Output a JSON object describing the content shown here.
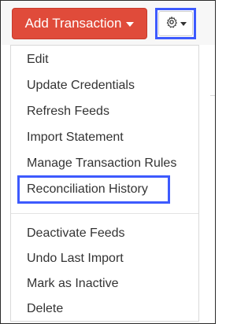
{
  "toolbar": {
    "add_transaction_label": "Add Transaction"
  },
  "menu": {
    "items": [
      {
        "label": "Edit"
      },
      {
        "label": "Update Credentials"
      },
      {
        "label": "Refresh Feeds"
      },
      {
        "label": "Import Statement"
      },
      {
        "label": "Manage Transaction Rules"
      },
      {
        "label": "Reconciliation History"
      },
      {
        "label": "Deactivate Feeds"
      },
      {
        "label": "Undo Last Import"
      },
      {
        "label": "Mark as Inactive"
      },
      {
        "label": "Delete"
      }
    ]
  },
  "colors": {
    "primary_button": "#e04b3a",
    "highlight_outline": "#3d5afe",
    "text": "#333333"
  },
  "icons": {
    "settings": "gear-icon",
    "dropdown": "caret-down-icon"
  }
}
